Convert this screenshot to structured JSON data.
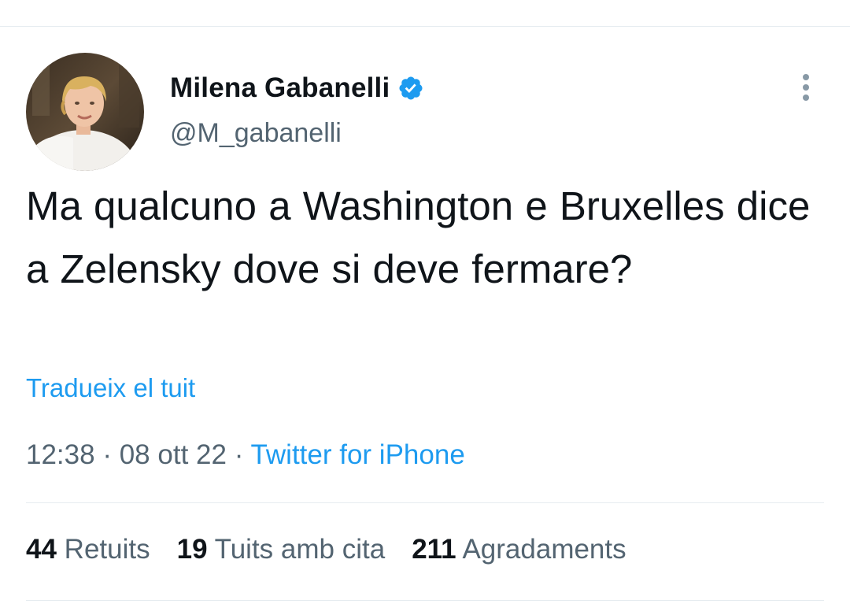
{
  "author": {
    "display_name": "Milena Gabanelli",
    "handle": "@M_gabanelli",
    "verified_icon": "verified-badge-icon",
    "avatar": "profile-photo"
  },
  "tweet": {
    "text": "Ma qualcuno a Washington e Bruxelles dice a Zelensky dove si deve fermare?",
    "translate_label": "Tradueix el tuit",
    "time": "12:38",
    "date": "08 ott 22",
    "separator": "·",
    "source": "Twitter for iPhone"
  },
  "stats": {
    "retweets": {
      "count": "44",
      "label": "Retuits"
    },
    "quotes": {
      "count": "19",
      "label": "Tuits amb cita"
    },
    "likes": {
      "count": "211",
      "label": "Agradaments"
    }
  },
  "colors": {
    "link": "#1d9bf0",
    "secondary_text": "#536471",
    "primary_text": "#0f1419",
    "divider": "#e6ecf0"
  }
}
